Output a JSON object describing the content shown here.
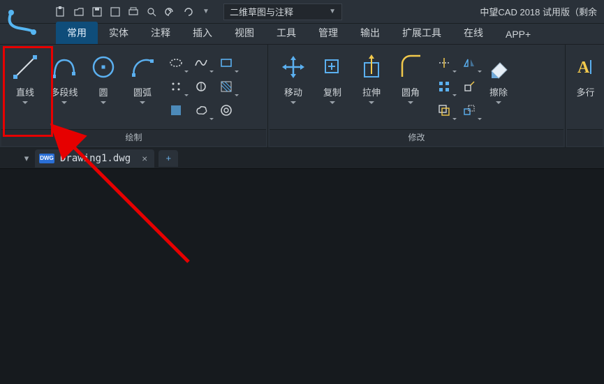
{
  "titlebar": {
    "workspace_label": "二维草图与注释",
    "app_title": "中望CAD 2018 试用版（剩余"
  },
  "tabs": [
    "常用",
    "实体",
    "注释",
    "插入",
    "视图",
    "工具",
    "管理",
    "输出",
    "扩展工具",
    "在线",
    "APP+"
  ],
  "active_tab_index": 0,
  "panels": {
    "draw": {
      "title": "绘制",
      "line": "直线",
      "pline": "多段线",
      "circle": "圆",
      "arc": "圆弧"
    },
    "modify": {
      "title": "修改",
      "move": "移动",
      "copy": "复制",
      "stretch": "拉伸",
      "fillet": "圆角",
      "erase": "擦除"
    },
    "text": {
      "mtext": "多行"
    }
  },
  "doctab": {
    "name": "Drawing1.dwg",
    "newtab_icon": "+"
  },
  "colors": {
    "accent": "#5bb0f0",
    "highlight": "#e60000",
    "bg": "#2a3139"
  }
}
